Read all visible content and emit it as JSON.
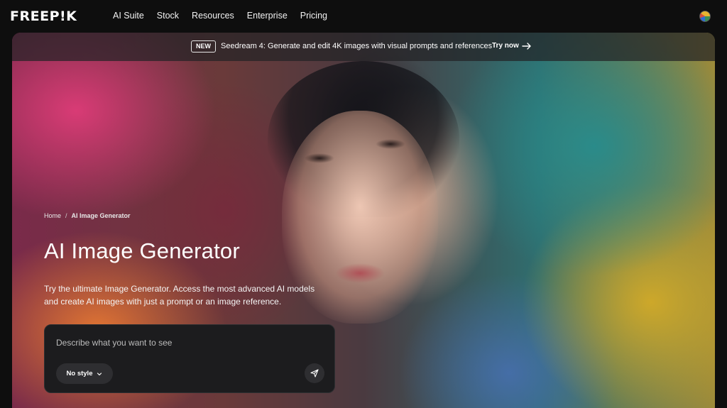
{
  "header": {
    "logo": "FREEP!K",
    "nav": [
      "AI Suite",
      "Stock",
      "Resources",
      "Enterprise",
      "Pricing"
    ]
  },
  "banner": {
    "badge": "NEW",
    "text": "Seedream 4: Generate and edit 4K images with visual prompts and references",
    "cta": "Try now",
    "icon": "arrow-right-icon"
  },
  "breadcrumb": {
    "home": "Home",
    "separator": "/",
    "current": "AI Image Generator"
  },
  "hero": {
    "title": "AI Image Generator",
    "description": "Try the ultimate Image Generator. Access the most advanced AI models and create AI images with just a prompt or an image reference."
  },
  "prompt": {
    "placeholder": "Describe what you want to see",
    "value": "",
    "style_label": "No style",
    "style_icon": "chevron-down-icon",
    "send_icon": "send-icon"
  },
  "colors": {
    "background": "#0e0e0e",
    "panel": "#1c1c1e",
    "button": "#2e2e31",
    "text": "#ffffff"
  }
}
